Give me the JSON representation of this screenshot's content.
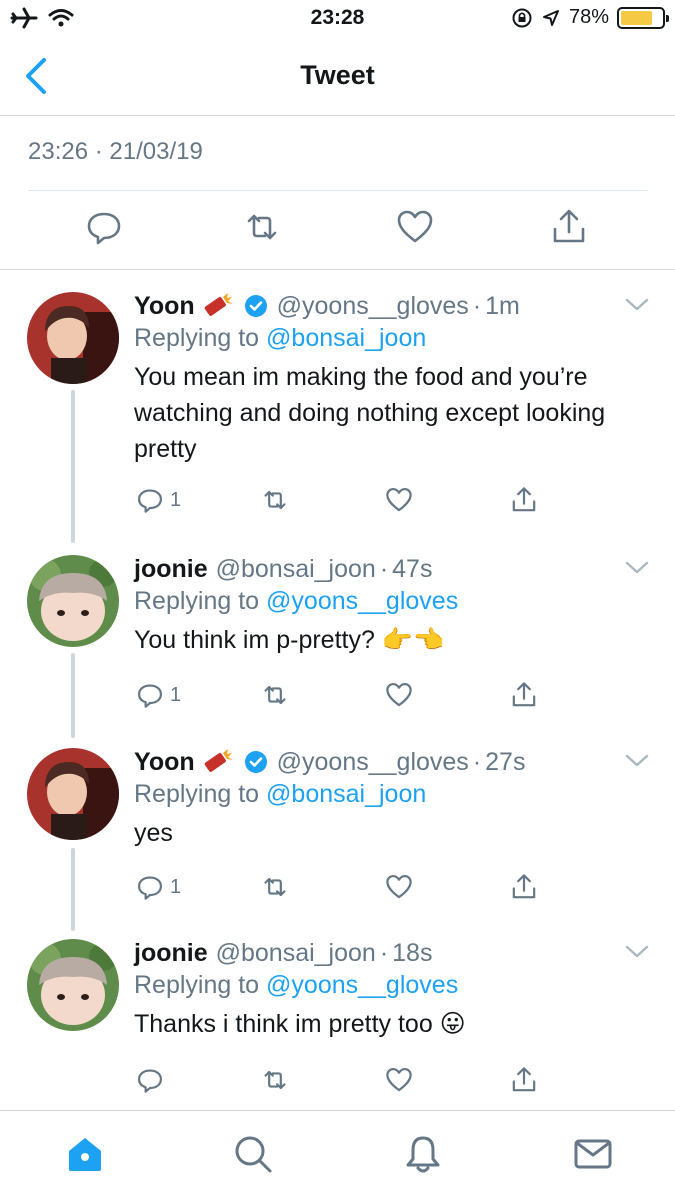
{
  "status_bar": {
    "time": "23:28",
    "battery": "78%"
  },
  "nav": {
    "title": "Tweet"
  },
  "tweet": {
    "timestamp": "23:26 · 21/03/19"
  },
  "colors": {
    "accent": "#1da1f2",
    "muted": "#657786",
    "battery": "#f6c945"
  },
  "replies": [
    {
      "name": "Yoon",
      "handle": "@yoons__gloves",
      "ago": "1m",
      "replying_prefix": "Replying to",
      "replying_to": "@bonsai_joon",
      "text": "You mean im making the food and you’re watching and doing nothing except looking pretty",
      "reply_count": "1"
    },
    {
      "name": "joonie",
      "handle": "@bonsai_joon",
      "ago": "47s",
      "replying_prefix": "Replying to",
      "replying_to": "@yoons__gloves",
      "text": "You think im p-pretty? 👉👈",
      "reply_count": "1"
    },
    {
      "name": "Yoon",
      "handle": "@yoons__gloves",
      "ago": "27s",
      "replying_prefix": "Replying to",
      "replying_to": "@bonsai_joon",
      "text": "yes",
      "reply_count": "1"
    },
    {
      "name": "joonie",
      "handle": "@bonsai_joon",
      "ago": "18s",
      "replying_prefix": "Replying to",
      "replying_to": "@yoons__gloves",
      "text": "Thanks i think im pretty too 😛",
      "reply_count": ""
    }
  ],
  "tab_bar": {
    "icons": [
      "home-icon",
      "search-icon",
      "notifications-icon",
      "messages-icon"
    ]
  }
}
